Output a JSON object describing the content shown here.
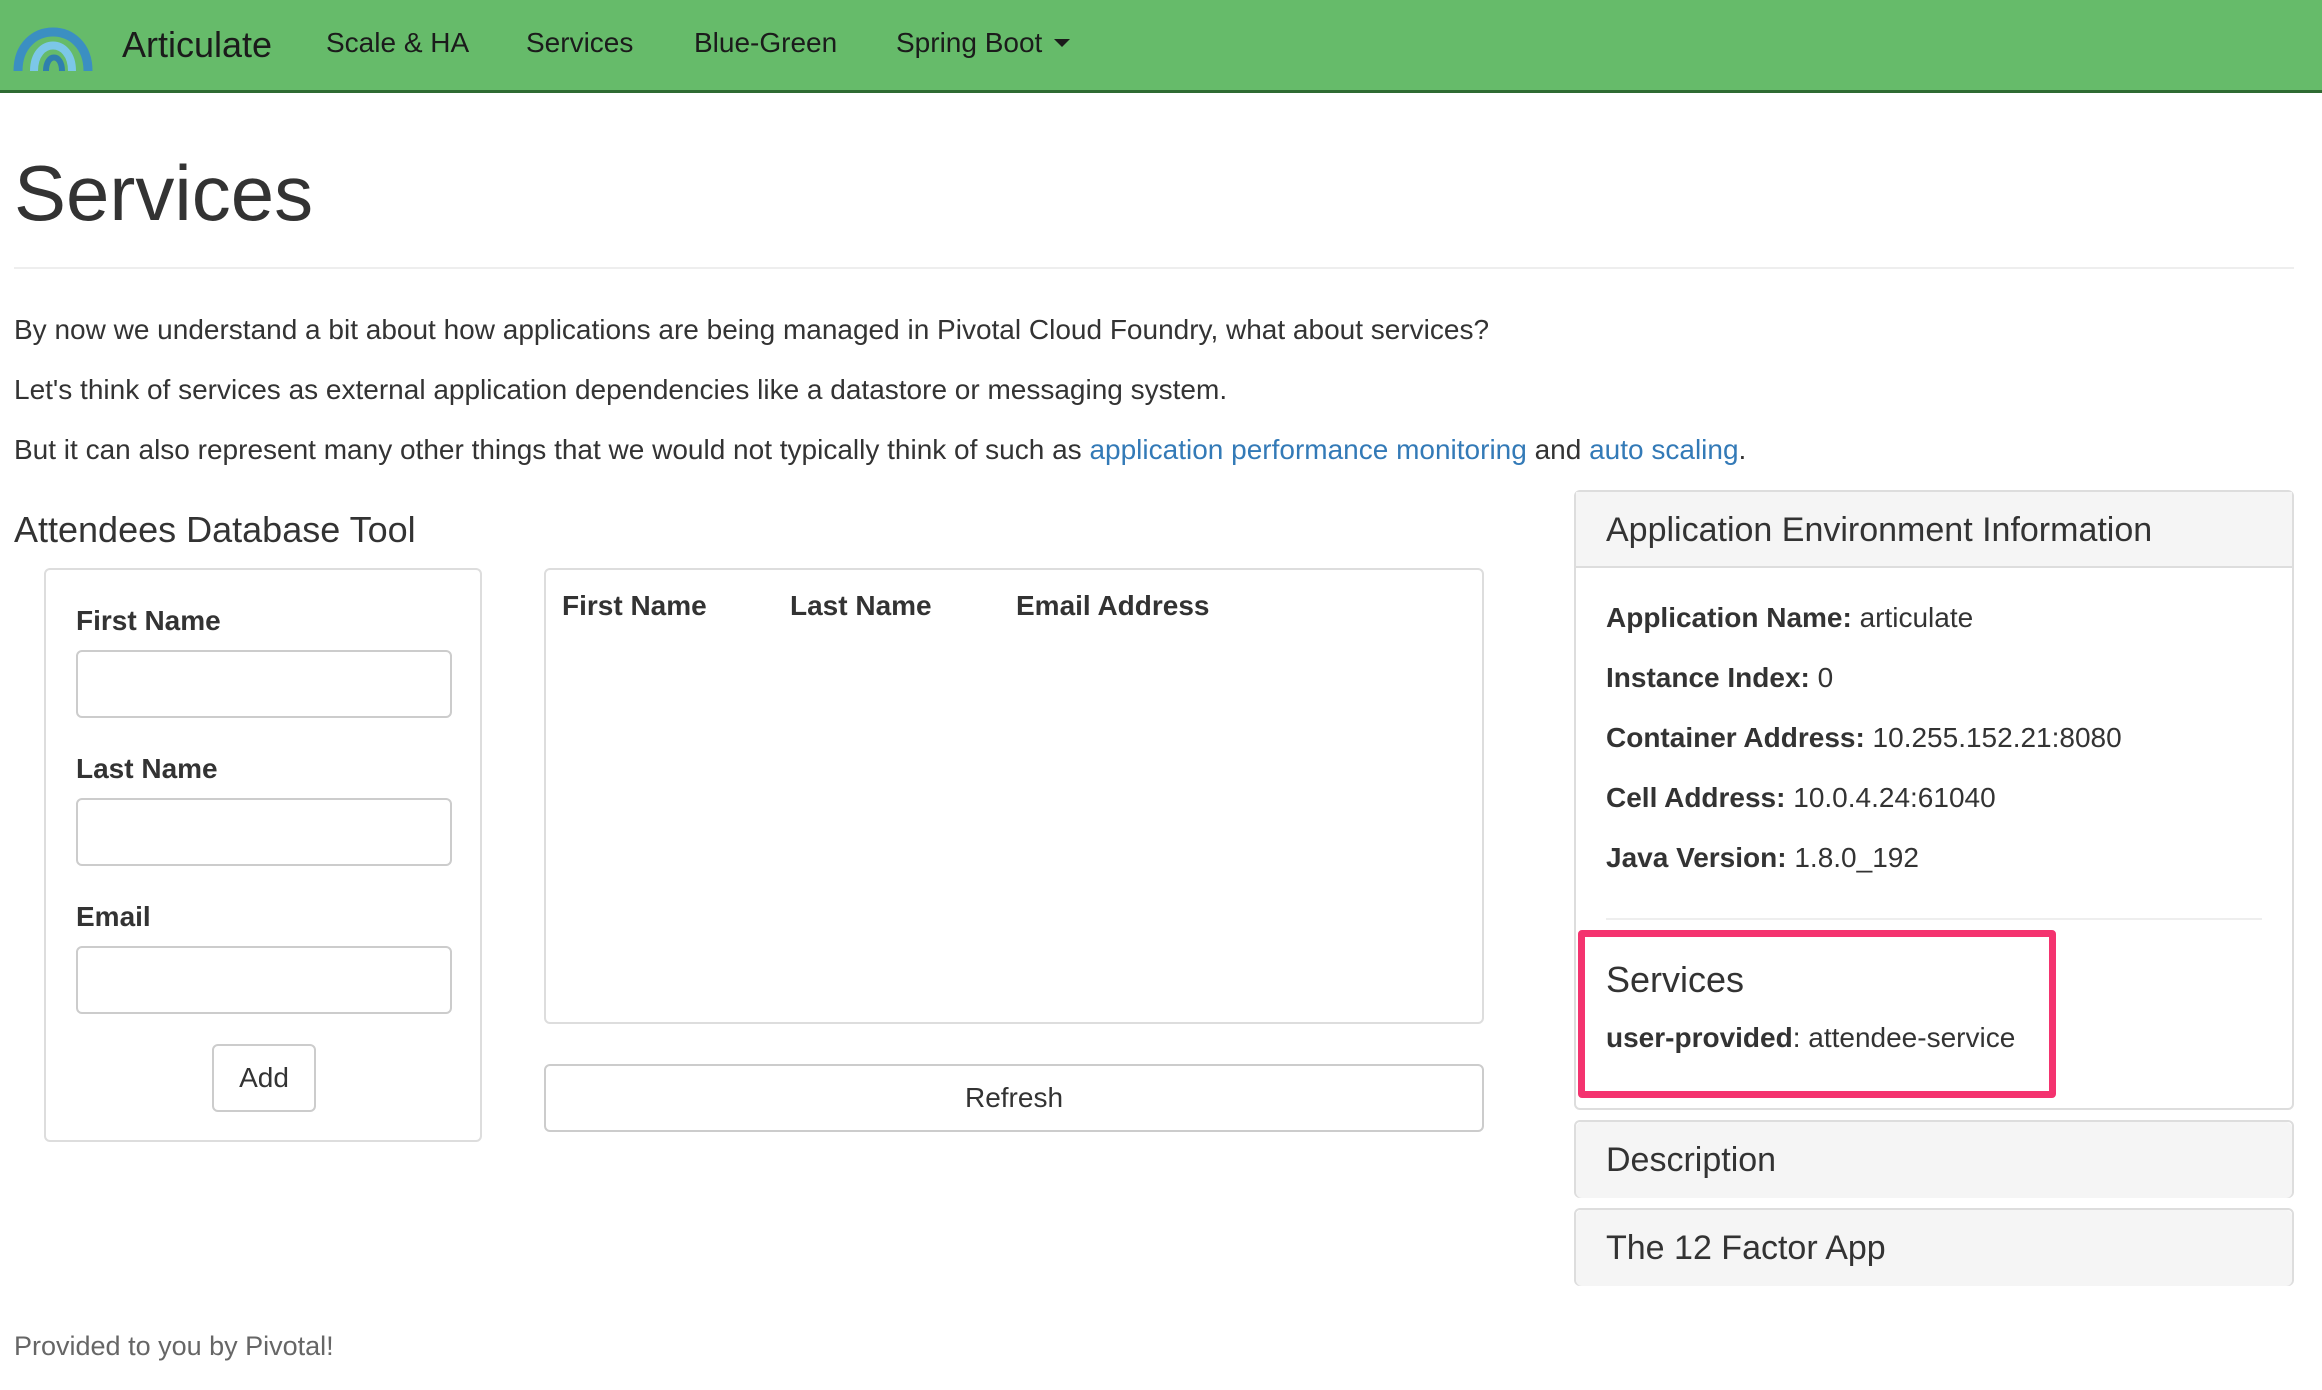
{
  "navbar": {
    "brand": "Articulate",
    "items": [
      {
        "label": "Scale & HA"
      },
      {
        "label": "Services"
      },
      {
        "label": "Blue-Green"
      },
      {
        "label": "Spring Boot"
      }
    ],
    "brand_color": "#66bb6a"
  },
  "page": {
    "title": "Services",
    "paragraphs": {
      "p1": "By now we understand a bit about how applications are being managed in Pivotal Cloud Foundry, what about services?",
      "p2": "Let's think of services as external application dependencies like a datastore or messaging system.",
      "p3_before": "But it can also represent many other things that we would not typically think of such as ",
      "p3_link1": "application performance monitoring",
      "p3_middle": " and ",
      "p3_link2": "auto scaling",
      "p3_after": "."
    }
  },
  "attendees": {
    "section_title": "Attendees Database Tool",
    "form": {
      "first_name_label": "First Name",
      "first_name_value": "",
      "last_name_label": "Last Name",
      "last_name_value": "",
      "email_label": "Email",
      "email_value": "",
      "add_label": "Add"
    },
    "table": {
      "columns": [
        "First Name",
        "Last Name",
        "Email Address"
      ],
      "rows": []
    },
    "refresh_label": "Refresh"
  },
  "sidebar": {
    "env_panel": {
      "heading": "Application Environment Information",
      "items": [
        {
          "label": "Application Name:",
          "value": " articulate"
        },
        {
          "label": "Instance Index:",
          "value": " 0"
        },
        {
          "label": "Container Address:",
          "value": " 10.255.152.21:8080"
        },
        {
          "label": "Cell Address:",
          "value": " 10.0.4.24:61040"
        },
        {
          "label": "Java Version:",
          "value": " 1.8.0_192"
        }
      ],
      "services_title": "Services",
      "service": {
        "label": "user-provided",
        "value": ": attendee-service"
      },
      "highlight_color": "#f4336f"
    },
    "description_heading": "Description",
    "twelve_factor_heading": "The 12 Factor App"
  },
  "footer": {
    "text": "Provided to you by Pivotal!"
  }
}
